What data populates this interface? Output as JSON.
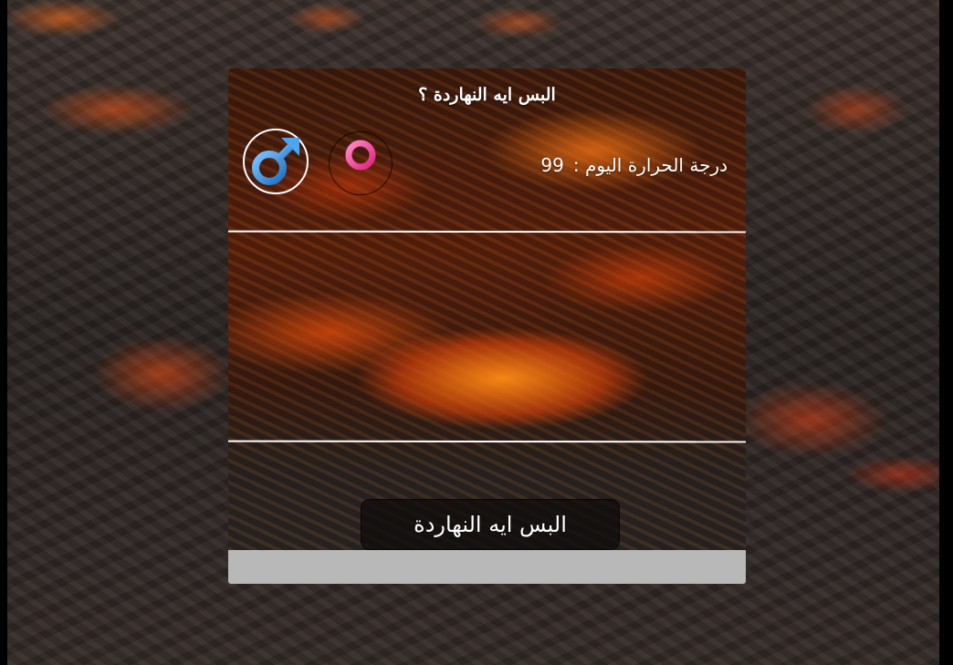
{
  "card": {
    "title": "البس ايه النهاردة ؟",
    "temperature_label": "درجة الحرارة اليوم :",
    "temperature_value": "99",
    "action_label": "البس ايه النهاردة"
  },
  "icons": {
    "male": "male-symbol-icon",
    "female": "female-symbol-icon"
  },
  "colors": {
    "male_icon": "#3aa0e8",
    "female_icon": "#ff4fa8",
    "footer_bar": "#b8b8b8"
  }
}
